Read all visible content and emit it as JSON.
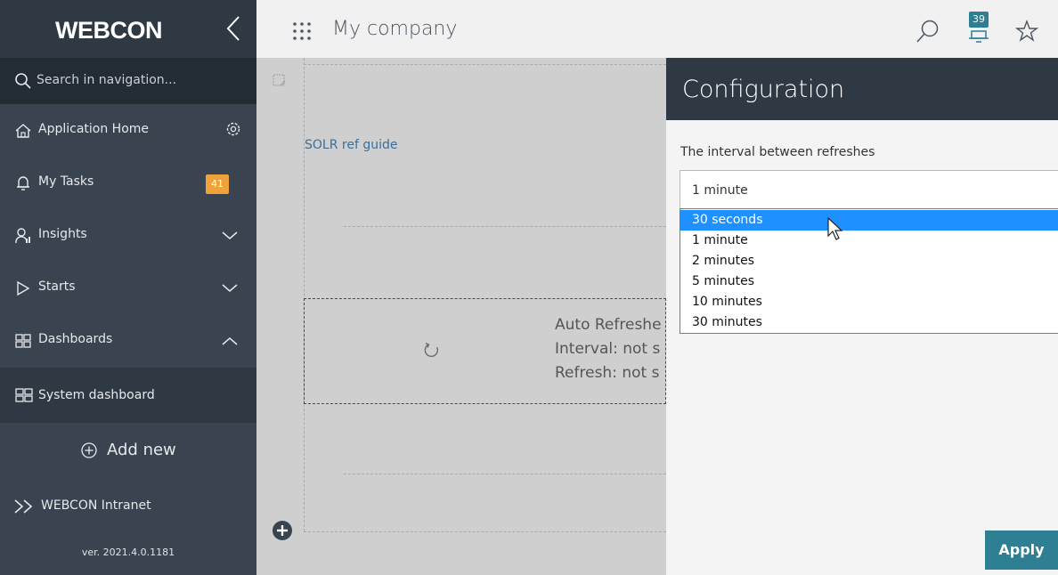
{
  "sidebar": {
    "brand": "WEBCON",
    "search_placeholder": "Search in navigation...",
    "items": [
      {
        "label": "Application Home"
      },
      {
        "label": "My Tasks",
        "badge": "41"
      },
      {
        "label": "Insights"
      },
      {
        "label": "Starts"
      },
      {
        "label": "Dashboards"
      }
    ],
    "sub_item": "System dashboard",
    "add_new": "Add new",
    "intranet": "WEBCON Intranet",
    "version": "ver. 2021.4.0.1181"
  },
  "topbar": {
    "title": "My company",
    "notifications_count": "39"
  },
  "canvas": {
    "link": "SOLR ref guide",
    "widget_lines": [
      "Auto Refreshe",
      "Interval: not s",
      "Refresh: not s"
    ]
  },
  "config": {
    "title": "Configuration",
    "field_label": "The interval between refreshes",
    "selected_value": "1 minute",
    "options": [
      "30 seconds",
      "1 minute",
      "2 minutes",
      "5 minutes",
      "10 minutes",
      "30 minutes"
    ],
    "highlighted_option": "30 seconds",
    "apply_label": "Apply"
  },
  "colors": {
    "sidebar_bg": "#3a4450",
    "accent": "#2e7e94",
    "badge": "#f0a23a",
    "option_highlight": "#1e90ff"
  }
}
